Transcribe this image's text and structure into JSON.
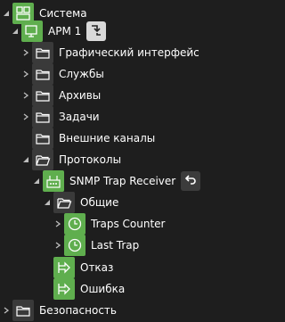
{
  "colors": {
    "background": "#1e1e1e",
    "accent_green": "#5fae4e",
    "folder_bg": "#3a3a3a",
    "text": "#ffffff",
    "chevron": "#bdbdbd"
  },
  "tree": {
    "system": {
      "label": "Система",
      "icon": "system-icon",
      "state": "expanded"
    },
    "arm1": {
      "label": "АРМ 1",
      "icon": "workstation-icon",
      "state": "expanded",
      "action_icon": "move-icon"
    },
    "gui": {
      "label": "Графический интерфейс",
      "icon": "folder-icon",
      "state": "collapsed"
    },
    "services": {
      "label": "Службы",
      "icon": "folder-icon",
      "state": "collapsed"
    },
    "archives": {
      "label": "Архивы",
      "icon": "folder-icon",
      "state": "collapsed"
    },
    "tasks": {
      "label": "Задачи",
      "icon": "folder-icon",
      "state": "collapsed"
    },
    "ext_channels": {
      "label": "Внешние каналы",
      "icon": "folder-icon",
      "state": "leaf"
    },
    "protocols": {
      "label": "Протоколы",
      "icon": "folder-icon",
      "state": "expanded"
    },
    "snmp_receiver": {
      "label": "SNMP Trap Receiver",
      "icon": "snmp-receiver-icon",
      "state": "expanded",
      "action_icon": "undo-icon"
    },
    "common": {
      "label": "Общие",
      "icon": "folder-icon",
      "state": "expanded"
    },
    "traps_counter": {
      "label": "Traps Counter",
      "icon": "clock-icon",
      "state": "collapsed"
    },
    "last_trap": {
      "label": "Last Trap",
      "icon": "clock-icon",
      "state": "collapsed"
    },
    "failure": {
      "label": "Отказ",
      "icon": "exit-arrow-icon",
      "state": "leaf"
    },
    "error": {
      "label": "Ошибка",
      "icon": "exit-arrow-icon",
      "state": "leaf"
    },
    "security": {
      "label": "Безопасность",
      "icon": "folder-icon",
      "state": "collapsed"
    }
  }
}
